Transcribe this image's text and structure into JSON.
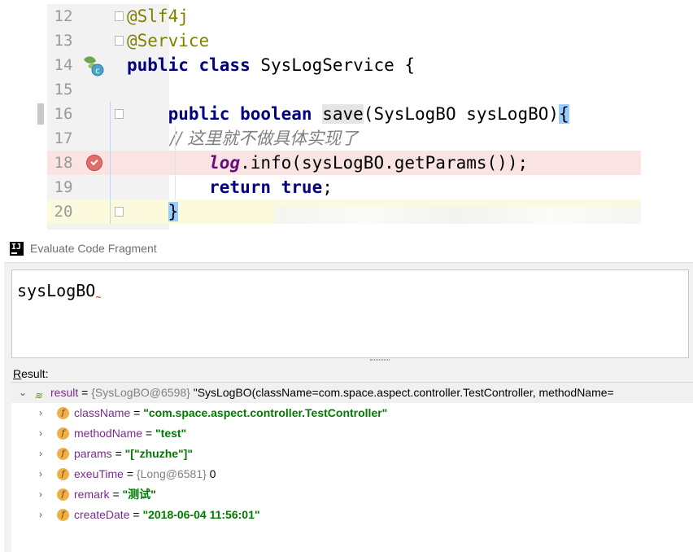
{
  "editor": {
    "lines": [
      {
        "num": "12",
        "tokens": [
          {
            "t": "@Slf4j",
            "c": "ann"
          }
        ]
      },
      {
        "num": "13",
        "tokens": [
          {
            "t": "@Service",
            "c": "ann"
          }
        ]
      },
      {
        "num": "14",
        "tokens": [
          {
            "t": "public class ",
            "c": "kw"
          },
          {
            "t": "SysLogService {",
            "c": ""
          }
        ]
      },
      {
        "num": "15",
        "tokens": []
      },
      {
        "num": "16",
        "tokens": [
          {
            "t": "    public boolean ",
            "c": "kw"
          },
          {
            "t": "save",
            "c": "hl"
          },
          {
            "t": "(SysLogBO sysLogBO)",
            "c": ""
          },
          {
            "t": "{",
            "c": "brace"
          }
        ]
      },
      {
        "num": "17",
        "tokens": [
          {
            "t": "        // 这里就不做具体实现了",
            "c": "cmt"
          }
        ]
      },
      {
        "num": "18",
        "tokens": [
          {
            "t": "        ",
            "c": ""
          },
          {
            "t": "log",
            "c": "fld"
          },
          {
            "t": ".info(sysLogBO.getParams());",
            "c": ""
          }
        ]
      },
      {
        "num": "19",
        "tokens": [
          {
            "t": "        return true",
            "c": "kw"
          },
          {
            "t": ";",
            "c": ""
          }
        ]
      },
      {
        "num": "20",
        "tokens": [
          {
            "t": "    ",
            "c": ""
          },
          {
            "t": "}",
            "c": "brace"
          }
        ]
      }
    ]
  },
  "dialog": {
    "title": "Evaluate Code Fragment",
    "expression": "sysLogBO",
    "result_label_underlined": "R",
    "result_label_rest": "esult:",
    "result_root": {
      "name": "result",
      "eq": " = ",
      "type": "{SysLogBO@6598} ",
      "value": "\"SysLogBO(className=com.space.aspect.controller.TestController, methodName="
    },
    "fields": [
      {
        "name": "className",
        "type": "",
        "value": "\"com.space.aspect.controller.TestController\"",
        "kind": "string"
      },
      {
        "name": "methodName",
        "type": "",
        "value": "\"test\"",
        "kind": "string"
      },
      {
        "name": "params",
        "type": "",
        "value": "\"[\"zhuzhe\"]\"",
        "kind": "string"
      },
      {
        "name": "exeuTime",
        "type": "{Long@6581} ",
        "value": "0",
        "kind": "plain"
      },
      {
        "name": "remark",
        "type": "",
        "value": "\"测试\"",
        "kind": "string"
      },
      {
        "name": "createDate",
        "type": "",
        "value": "\"2018-06-04 11:56:01\"",
        "kind": "string"
      }
    ]
  },
  "icons": {
    "spring_bean": "spring-bean-class-icon",
    "breakpoint": "breakpoint-icon",
    "field": "field-icon",
    "watch_result": "watch-result-icon",
    "app_logo": "intellij-logo-icon"
  }
}
